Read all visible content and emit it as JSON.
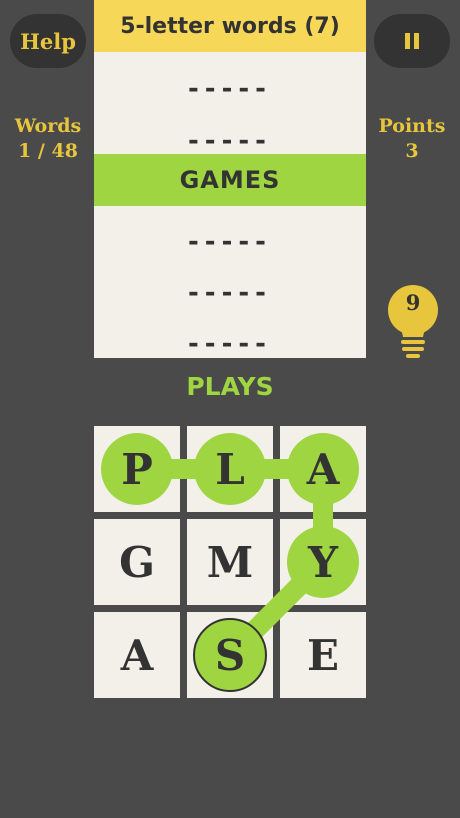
{
  "header": {
    "help_label": "Help",
    "pause_icon": "pause-icon",
    "panel_title": "5-letter words (7)"
  },
  "stats": {
    "words_label": "Words",
    "words_value": "1 / 48",
    "points_label": "Points",
    "points_value": "3"
  },
  "word_list": [
    {
      "text": "-----",
      "found": false
    },
    {
      "text": "-----",
      "found": false
    },
    {
      "text": "GAMES",
      "found": true
    },
    {
      "text": "-----",
      "found": false
    },
    {
      "text": "-----",
      "found": false
    },
    {
      "text": "-----",
      "found": false
    }
  ],
  "hint": {
    "icon": "lightbulb-icon",
    "count": "9"
  },
  "current_word": "PLAYS",
  "grid": {
    "rows": [
      [
        "P",
        "L",
        "A"
      ],
      [
        "G",
        "M",
        "Y"
      ],
      [
        "A",
        "S",
        "E"
      ]
    ],
    "selected_path": [
      [
        0,
        0
      ],
      [
        0,
        1
      ],
      [
        0,
        2
      ],
      [
        1,
        2
      ],
      [
        2,
        1
      ]
    ]
  },
  "colors": {
    "background": "#4a4a4a",
    "accent_yellow": "#e7c53d",
    "header_yellow": "#f6d758",
    "highlight_green": "#9fd540",
    "tile": "#f3f0ea",
    "dark": "#333333"
  }
}
